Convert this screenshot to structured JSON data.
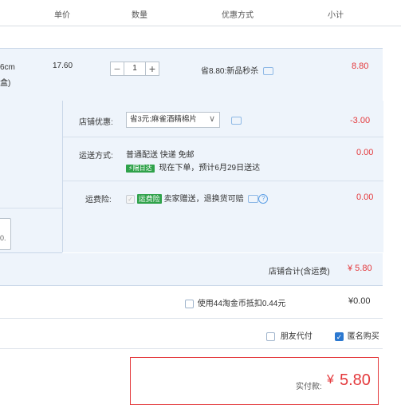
{
  "header": {
    "price": "单价",
    "qty": "数量",
    "promo": "优惠方式",
    "subtotal": "小计"
  },
  "item": {
    "spec_line1": "6cm",
    "spec_line2": "盒)",
    "price": "17.60",
    "quantity": "1",
    "minus": "−",
    "plus": "+",
    "promo": "省8.80:新品秒杀",
    "subtotal": "8.80"
  },
  "shop": {
    "discount_label": "店铺优惠:",
    "discount_select": "省3元:麻雀酒精棉片",
    "discount_value": "-3.00",
    "shipping_label": "运送方式:",
    "shipping_text": "普通配送 快递 免邮",
    "shipping_badge": "隔日达",
    "shipping_note": "现在下单，预计6月29日送达",
    "shipping_value": "0.00",
    "insurance_label": "运费险:",
    "insurance_badge": "运费险",
    "insurance_text": "卖家赠送，退换货可赔",
    "insurance_value": "0.00"
  },
  "msg_box_text": "0.",
  "shop_total": {
    "label": "店铺合计(含运费)",
    "value": "¥ 5.80"
  },
  "coin": {
    "label": "使用44淘金币抵扣0.44元",
    "value": "¥0.00"
  },
  "options": {
    "friend_pay": "朋友代付",
    "anonymous": "匿名购买"
  },
  "pay": {
    "label": "实付款:",
    "currency": "¥",
    "amount": "5.80"
  },
  "colors": {
    "accent_red": "#e4393c",
    "panel_blue": "#eef4fb",
    "checkbox_blue": "#2b78d0",
    "badge_green": "#2fa24a"
  }
}
